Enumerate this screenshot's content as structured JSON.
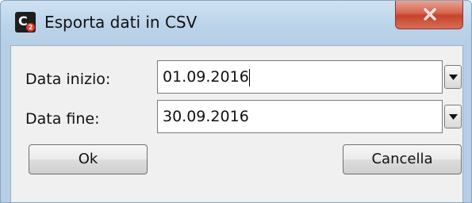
{
  "window": {
    "title": "Esporta dati in CSV",
    "icon_name": "c2-app-icon",
    "icon_letter": "C",
    "icon_badge": "2",
    "close_icon": "close-icon"
  },
  "form": {
    "start_label": "Data inizio:",
    "start_value": "01.09.2016",
    "end_label": "Data fine:",
    "end_value": "30.09.2016",
    "dropdown_icon": "chevron-down-icon"
  },
  "buttons": {
    "ok_label": "Ok",
    "cancel_label": "Cancella"
  },
  "colors": {
    "close_button": "#c6432a",
    "frame": "#b6cfe6",
    "client_bg": "#f0f0f0"
  }
}
